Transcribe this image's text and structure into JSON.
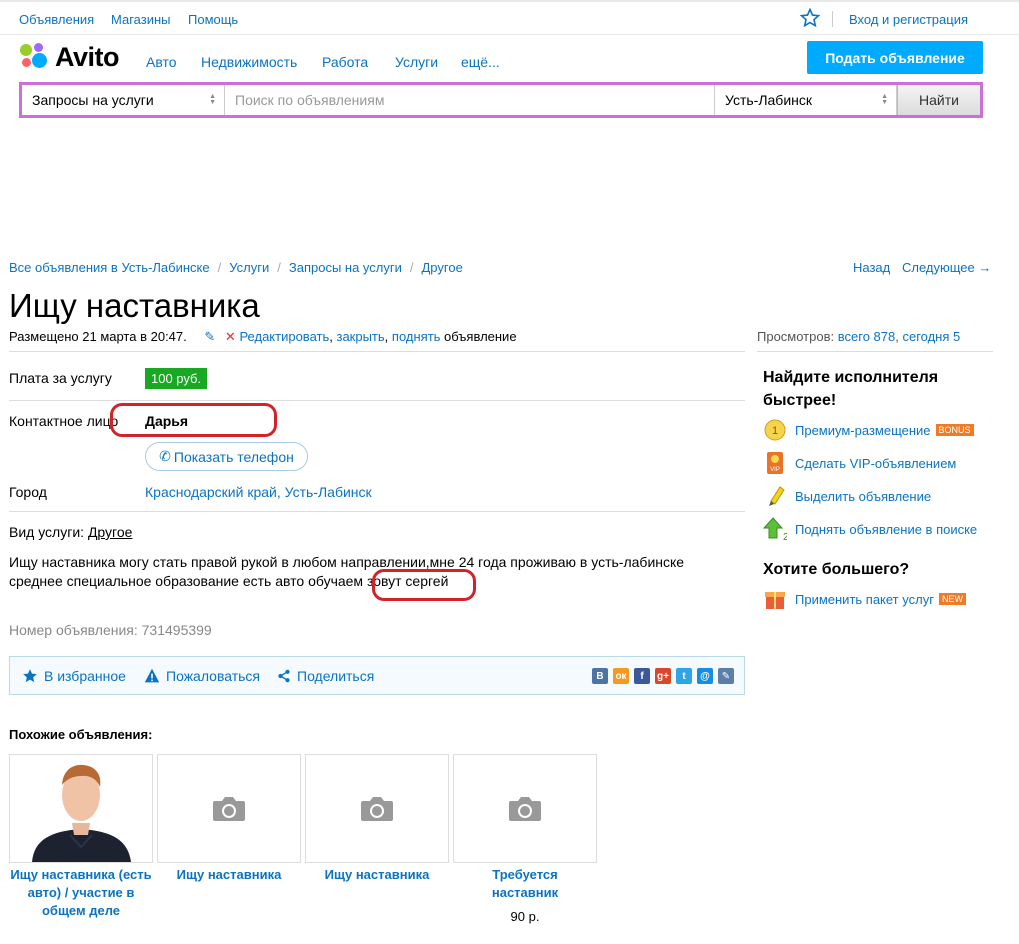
{
  "topbar": {
    "links": [
      "Объявления",
      "Магазины",
      "Помощь"
    ],
    "login": "Вход и регистрация"
  },
  "header": {
    "logo_text": "Avito",
    "nav": [
      "Авто",
      "Недвижимость",
      "Работа",
      "Услуги",
      "ещё..."
    ],
    "post_button": "Подать объявление"
  },
  "search": {
    "category": "Запросы на услуги",
    "placeholder": "Поиск по объявлениям",
    "city": "Усть-Лабинск",
    "button": "Найти"
  },
  "breadcrumbs": [
    "Все объявления в Усть-Лабинске",
    "Услуги",
    "Запросы на услуги",
    "Другое"
  ],
  "pager": {
    "back": "Назад",
    "next": "Следующее →"
  },
  "ad": {
    "title": "Ищу наставника",
    "posted": "Размещено 21 марта в 20:47.",
    "edit_links": [
      "Редактировать",
      "закрыть",
      "поднять"
    ],
    "edit_suffix": "объявление",
    "views_label": "Просмотров:",
    "views_total": "всего 878",
    "views_today": "сегодня 5",
    "price_label": "Плата за услугу",
    "price": "100 руб.",
    "contact_label": "Контактное лицо",
    "contact_name": "Дарья",
    "phone_button": "Показать телефон",
    "city_label": "Город",
    "city_region": "Краснодарский край",
    "city_name": "Усть-Лабинск",
    "service_label": "Вид услуги:",
    "service_value": "Другое",
    "description_line1": "Ищу наставника могу стать правой рукой в любом направлении,мне 24 года проживаю в усть-лабинске",
    "description_line2_a": "среднее специальное образование есть авто обучаем",
    "description_line2_b": "зовут сергей",
    "number": "Номер объявления: 731495399"
  },
  "actions": {
    "favorite": "В избранное",
    "complain": "Пожаловаться",
    "share": "Поделиться",
    "social": [
      {
        "glyph": "В",
        "color": "#4c75a3"
      },
      {
        "glyph": "ок",
        "color": "#f59a1e"
      },
      {
        "glyph": "f",
        "color": "#3b5998"
      },
      {
        "glyph": "g+",
        "color": "#d9472b"
      },
      {
        "glyph": "t",
        "color": "#2fa5e6"
      },
      {
        "glyph": "@",
        "color": "#168de2"
      },
      {
        "glyph": "✎",
        "color": "#5b7fa8"
      }
    ]
  },
  "sidebar": {
    "heading1": "Найдите исполнителя быстрее!",
    "items": [
      {
        "label": "Премиум-размещение",
        "icon": "premium-coin-icon",
        "tag": "BONUS",
        "tag_color": "#f07a25"
      },
      {
        "label": "Сделать VIP-объявлением",
        "icon": "vip-icon"
      },
      {
        "label": "Выделить объявление",
        "icon": "highlighter-icon"
      },
      {
        "label": "Поднять объявление в поиске",
        "icon": "up-arrow-icon"
      }
    ],
    "heading2": "Хотите большего?",
    "package": {
      "label": "Применить пакет услуг",
      "icon": "gift-box-icon",
      "tag": "NEW",
      "tag_color": "#f07a25"
    }
  },
  "similar": {
    "title": "Похожие объявления:",
    "items": [
      {
        "title": "Ищу наставника (есть авто) / участие в общем деле",
        "image": "person-photo",
        "price": ""
      },
      {
        "title": "Ищу наставника",
        "image": "camera-placeholder-icon",
        "price": ""
      },
      {
        "title": "Ищу наставника",
        "image": "camera-placeholder-icon",
        "price": ""
      },
      {
        "title": "Требуется наставник",
        "image": "camera-placeholder-icon",
        "price": "90 р."
      }
    ]
  }
}
